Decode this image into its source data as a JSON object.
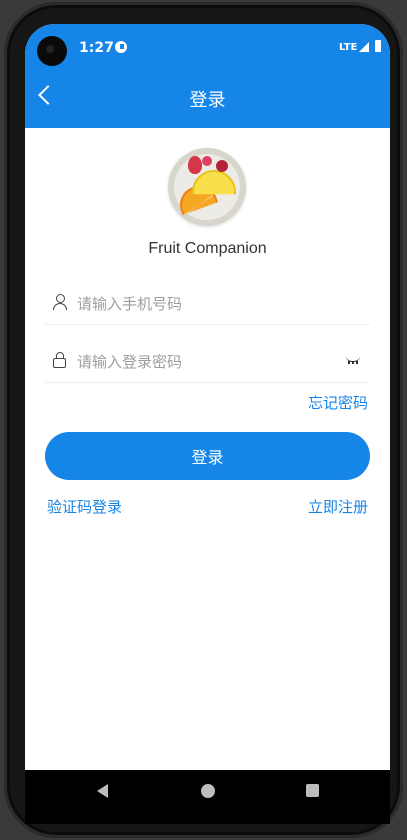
{
  "status_bar": {
    "time": "1:27",
    "network": "LTE"
  },
  "header": {
    "title": "登录",
    "back_icon": "chevron-left-icon"
  },
  "app": {
    "name": "Fruit Companion",
    "logo_icon": "fruit-plate-logo"
  },
  "form": {
    "phone_placeholder": "请输入手机号码",
    "password_placeholder": "请输入登录密码",
    "forgot_password": "忘记密码",
    "login_button": "登录",
    "code_login": "验证码登录",
    "register": "立即注册"
  },
  "colors": {
    "primary": "#1685e8",
    "placeholder": "#9e9e9e",
    "divider": "#eeeeee"
  }
}
